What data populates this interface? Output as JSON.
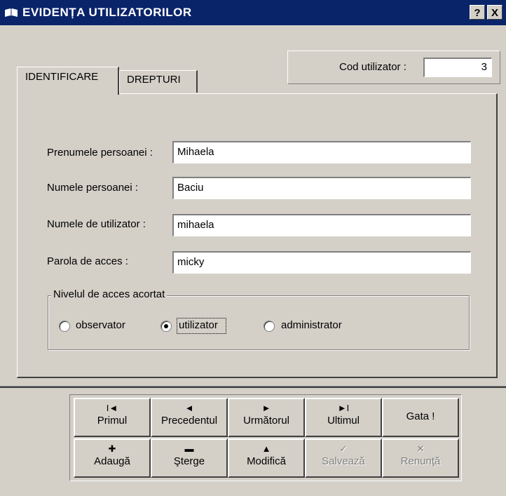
{
  "window": {
    "title": "EVIDENȚA UTILIZATORILOR",
    "help_button": "?",
    "close_button": "X"
  },
  "code": {
    "label": "Cod utilizator :",
    "value": "3"
  },
  "tabs": [
    {
      "label": "IDENTIFICARE",
      "active": true
    },
    {
      "label": "DREPTURI",
      "active": false
    }
  ],
  "form": {
    "first_name_label": "Prenumele persoanei :",
    "first_name_value": "Mihaela",
    "last_name_label": "Numele persoanei :",
    "last_name_value": "Baciu",
    "username_label": "Numele de utilizator :",
    "username_value": "mihaela",
    "password_label": "Parola de acces :",
    "password_value": "micky"
  },
  "access_level": {
    "legend": "Nivelul de acces acortat",
    "options": [
      {
        "label": "observator",
        "selected": false
      },
      {
        "label": "utilizator",
        "selected": true
      },
      {
        "label": "administrator",
        "selected": false
      }
    ]
  },
  "nav_buttons": [
    {
      "glyph": "I◄",
      "label": "Primul",
      "enabled": true
    },
    {
      "glyph": "◄",
      "label": "Precedentul",
      "enabled": true
    },
    {
      "glyph": "►",
      "label": "Următorul",
      "enabled": true
    },
    {
      "glyph": "►I",
      "label": "Ultimul",
      "enabled": true
    },
    {
      "glyph": "",
      "label": "Gata !",
      "enabled": true
    }
  ],
  "action_buttons": [
    {
      "glyph": "✚",
      "label": "Adaugă",
      "enabled": true
    },
    {
      "glyph": "▬",
      "label": "Şterge",
      "enabled": true
    },
    {
      "glyph": "▲",
      "label": "Modifică",
      "enabled": true
    },
    {
      "glyph": "✓",
      "label": "Salvează",
      "enabled": false
    },
    {
      "glyph": "✕",
      "label": "Renunţă",
      "enabled": false
    }
  ]
}
